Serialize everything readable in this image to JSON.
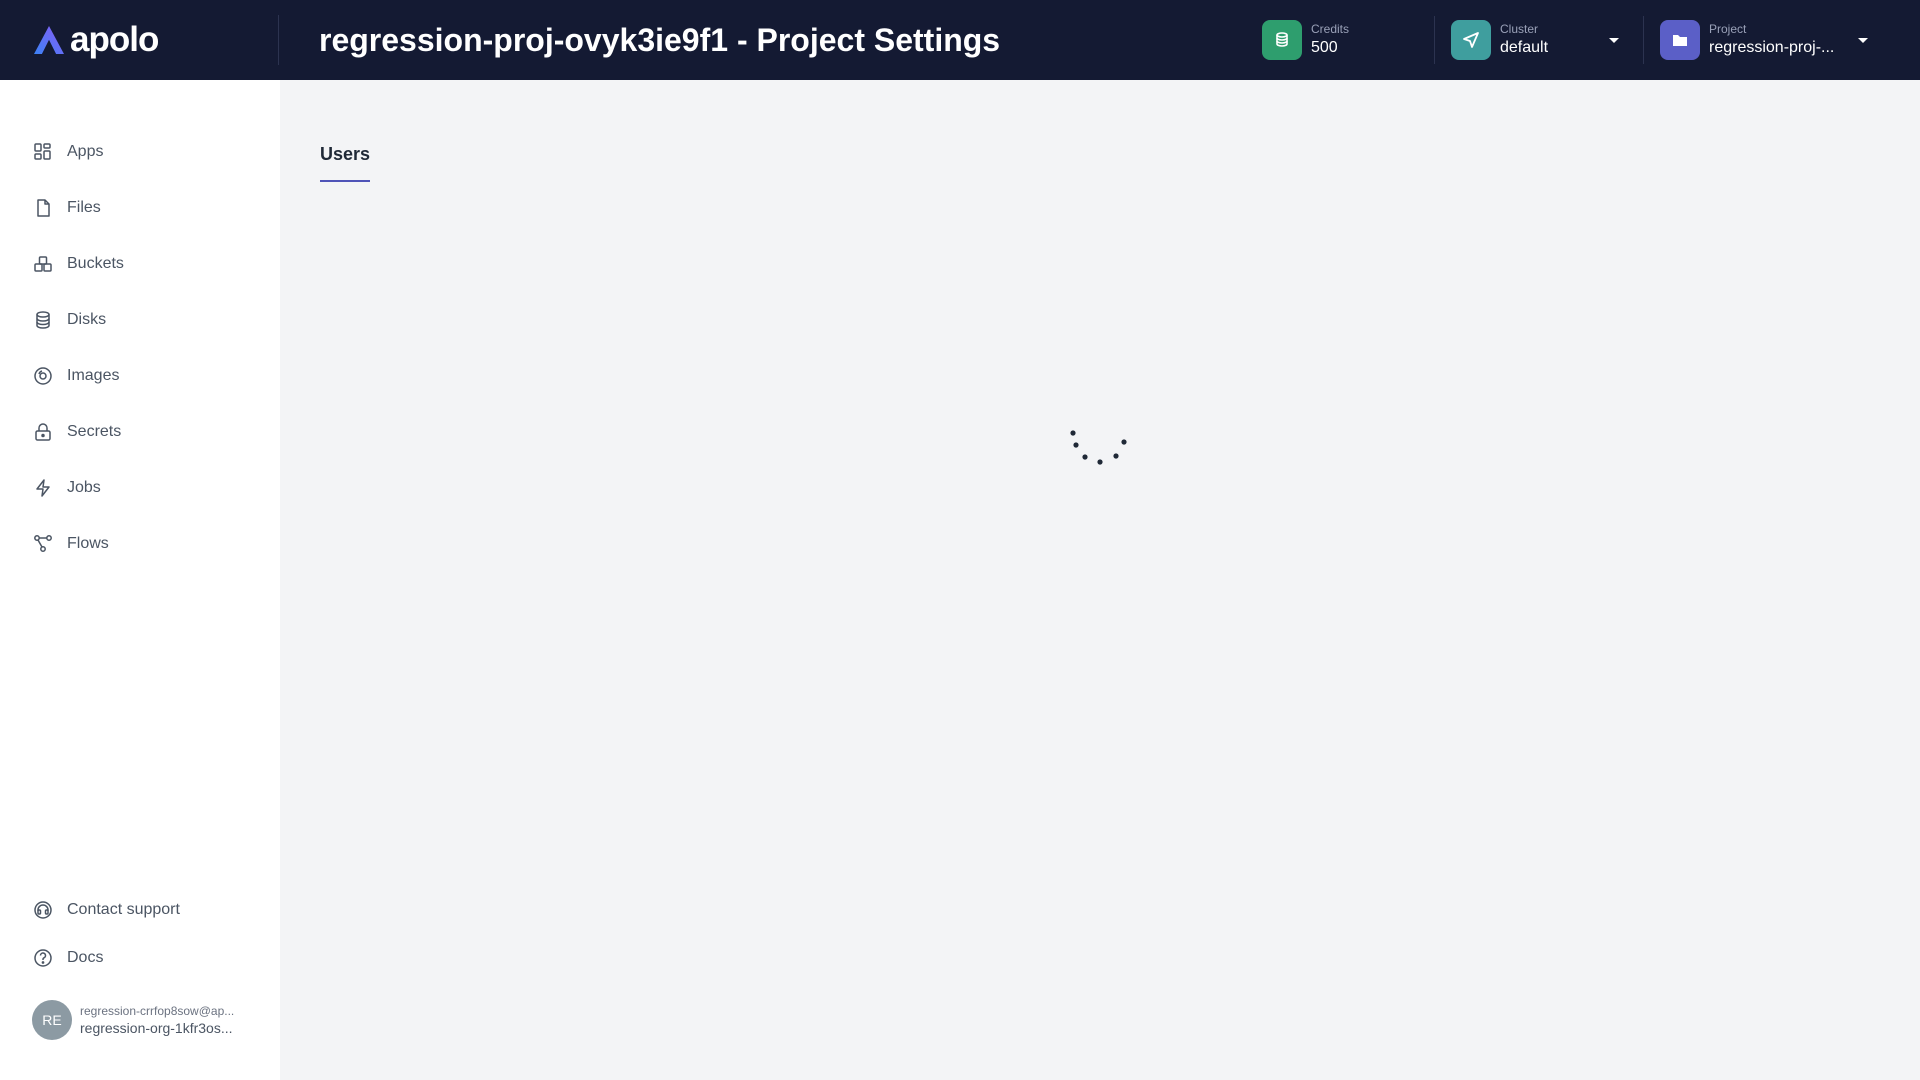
{
  "app": {
    "logo_text": "apolo"
  },
  "header": {
    "title": "regression-proj-ovyk3ie9f1 - Project Settings",
    "credits": {
      "caption": "Credits",
      "value": "500",
      "icon": "coins-icon",
      "color": "#2e9e6e"
    },
    "cluster": {
      "caption": "Cluster",
      "value": "default",
      "icon": "send-icon",
      "color": "#3f9e9e"
    },
    "project": {
      "caption": "Project",
      "value": "regression-proj-...",
      "icon": "folder-icon",
      "color": "#5b5fc7"
    }
  },
  "sidebar": {
    "items": [
      {
        "label": "Apps",
        "icon": "apps-grid-icon"
      },
      {
        "label": "Files",
        "icon": "file-icon"
      },
      {
        "label": "Buckets",
        "icon": "buckets-icon"
      },
      {
        "label": "Disks",
        "icon": "database-icon"
      },
      {
        "label": "Images",
        "icon": "image-disc-icon"
      },
      {
        "label": "Secrets",
        "icon": "lock-icon"
      },
      {
        "label": "Jobs",
        "icon": "lightning-icon"
      },
      {
        "label": "Flows",
        "icon": "flows-icon"
      }
    ],
    "footer": [
      {
        "label": "Contact support",
        "icon": "headset-icon"
      },
      {
        "label": "Docs",
        "icon": "help-circle-icon"
      }
    ],
    "user": {
      "initials": "RE",
      "email": "regression-crrfop8sow@ap...",
      "org": "regression-org-1kfr3os..."
    }
  },
  "main": {
    "tabs": [
      {
        "label": "Users",
        "active": true
      }
    ],
    "loading": true
  },
  "colors": {
    "header_bg": "#141a33",
    "accent": "#4f54b8",
    "page_bg": "#f3f4f6"
  }
}
